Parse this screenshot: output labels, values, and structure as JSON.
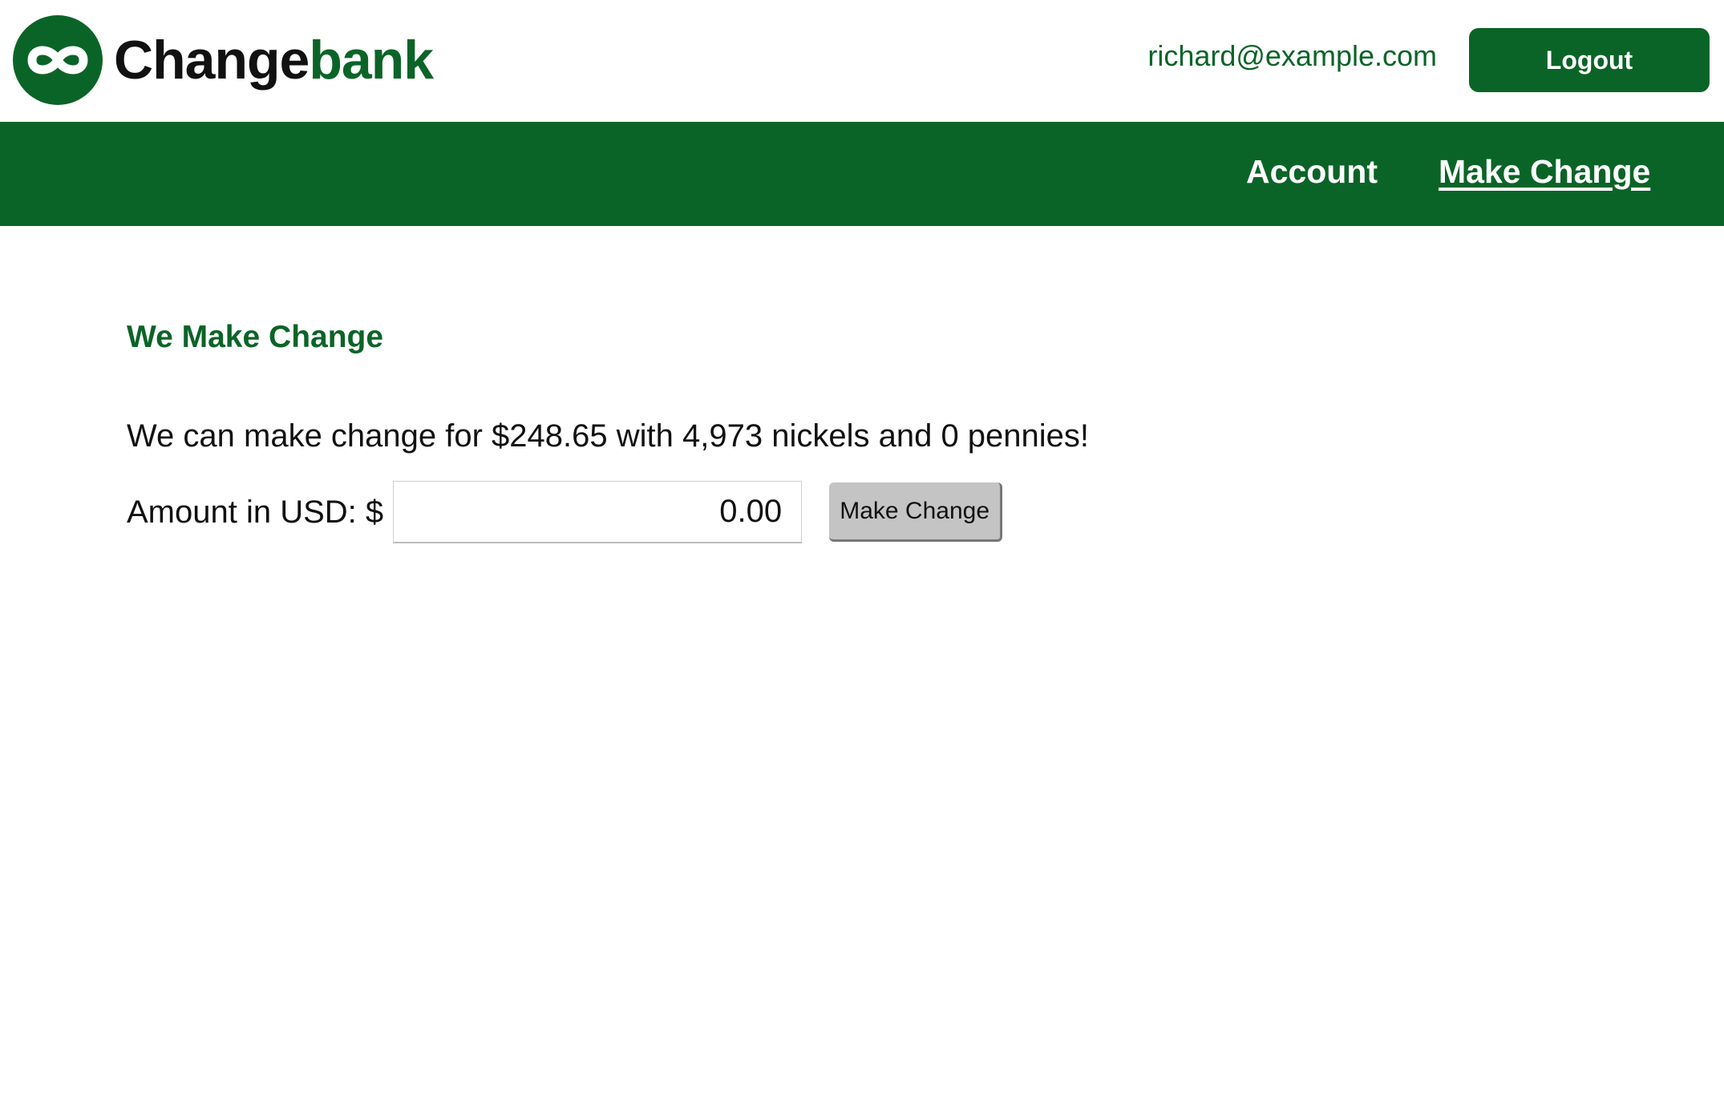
{
  "header": {
    "logo": {
      "icon": "infinity-link-icon",
      "name_part1": "Change",
      "name_part2": "bank"
    },
    "user_email": "richard@example.com",
    "logout_label": "Logout"
  },
  "nav": {
    "items": [
      {
        "label": "Account",
        "active": false
      },
      {
        "label": "Make Change",
        "active": true
      }
    ]
  },
  "main": {
    "title": "We Make Change",
    "message": "We can make change for $248.65 with 4,973 nickels and 0 pennies!",
    "amount_label": "Amount in USD: $",
    "amount_value": "0.00",
    "submit_label": "Make Change"
  },
  "colors": {
    "brand_green": "#0b6427",
    "button_gray": "#c4c4c4",
    "text": "#111111"
  }
}
